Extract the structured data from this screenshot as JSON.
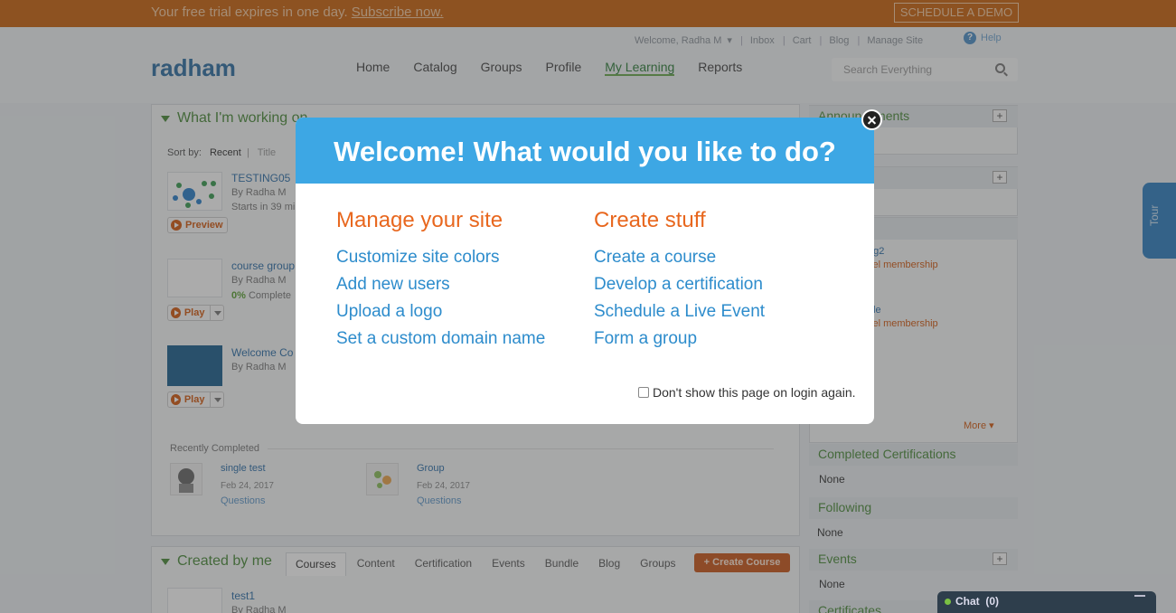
{
  "trial_bar": {
    "text": "Your free trial expires in one day.",
    "subscribe_link": "Subscribe now.",
    "demo_button": "SCHEDULE A DEMO"
  },
  "util_nav": {
    "welcome": "Welcome, Radha M",
    "links": [
      "Inbox",
      "Cart",
      "Blog",
      "Manage Site"
    ],
    "help": "Help"
  },
  "brand": {
    "logo": "radham"
  },
  "main_nav": [
    "Home",
    "Catalog",
    "Groups",
    "Profile",
    "My Learning",
    "Reports"
  ],
  "search": {
    "placeholder": "Search Everything"
  },
  "working_on": {
    "title": "What I'm working on",
    "sort_label": "Sort by:",
    "sort_options": [
      "Recent",
      "Title"
    ],
    "courses": [
      {
        "title": "TESTING05",
        "author": "By Radha M",
        "status": "Starts in 39 mi",
        "action": "Preview"
      },
      {
        "title": "course group",
        "author": "By Radha M",
        "percent": "0%",
        "status": "Complete",
        "action": "Play"
      },
      {
        "title": "Welcome Co",
        "author": "By Radha M",
        "action": "Play"
      }
    ],
    "recently_completed_label": "Recently Completed",
    "completed": [
      {
        "title": "single test",
        "date": "Feb 24, 2017",
        "link": "Questions"
      },
      {
        "title": "Group",
        "date": "Feb 24, 2017",
        "link": "Questions"
      }
    ]
  },
  "created_by_me": {
    "title": "Created by me",
    "tabs": [
      "Courses",
      "Content",
      "Certification",
      "Events",
      "Bundle",
      "Blog",
      "Groups"
    ],
    "create_button": "+ Create Course",
    "first_item": {
      "title": "test1",
      "author": "By Radha M"
    }
  },
  "sidebar": {
    "announcements": "Announcements",
    "group_items": [
      {
        "name": "ng2",
        "link": "cel membership"
      },
      {
        "name": "ple",
        "link": "cel membership"
      },
      {
        "name": "s"
      }
    ],
    "more": "More",
    "completed_certifications": {
      "title": "Completed Certifications",
      "value": "None"
    },
    "following": {
      "title": "Following",
      "value": "None"
    },
    "events": {
      "title": "Events",
      "value": "None"
    },
    "certificates": {
      "title": "Certificates"
    }
  },
  "tour": {
    "label": "Tour"
  },
  "chat": {
    "label": "Chat",
    "count": "(0)"
  },
  "modal": {
    "title": "Welcome! What would you like to do?",
    "manage": {
      "heading": "Manage your site",
      "options": [
        "Customize site colors",
        "Add new users",
        "Upload a logo",
        "Set a custom domain name"
      ]
    },
    "create": {
      "heading": "Create stuff",
      "options": [
        "Create a course",
        "Develop a certification",
        "Schedule a Live Event",
        "Form a group"
      ]
    },
    "dont_show": "Don't show this page on login again."
  },
  "colors": {
    "trial_bar": "#c8620e",
    "modal_header": "#3da7e4",
    "heading_orange": "#e8671e",
    "link_blue": "#2d8ccc",
    "section_green": "#4a8a3a"
  }
}
